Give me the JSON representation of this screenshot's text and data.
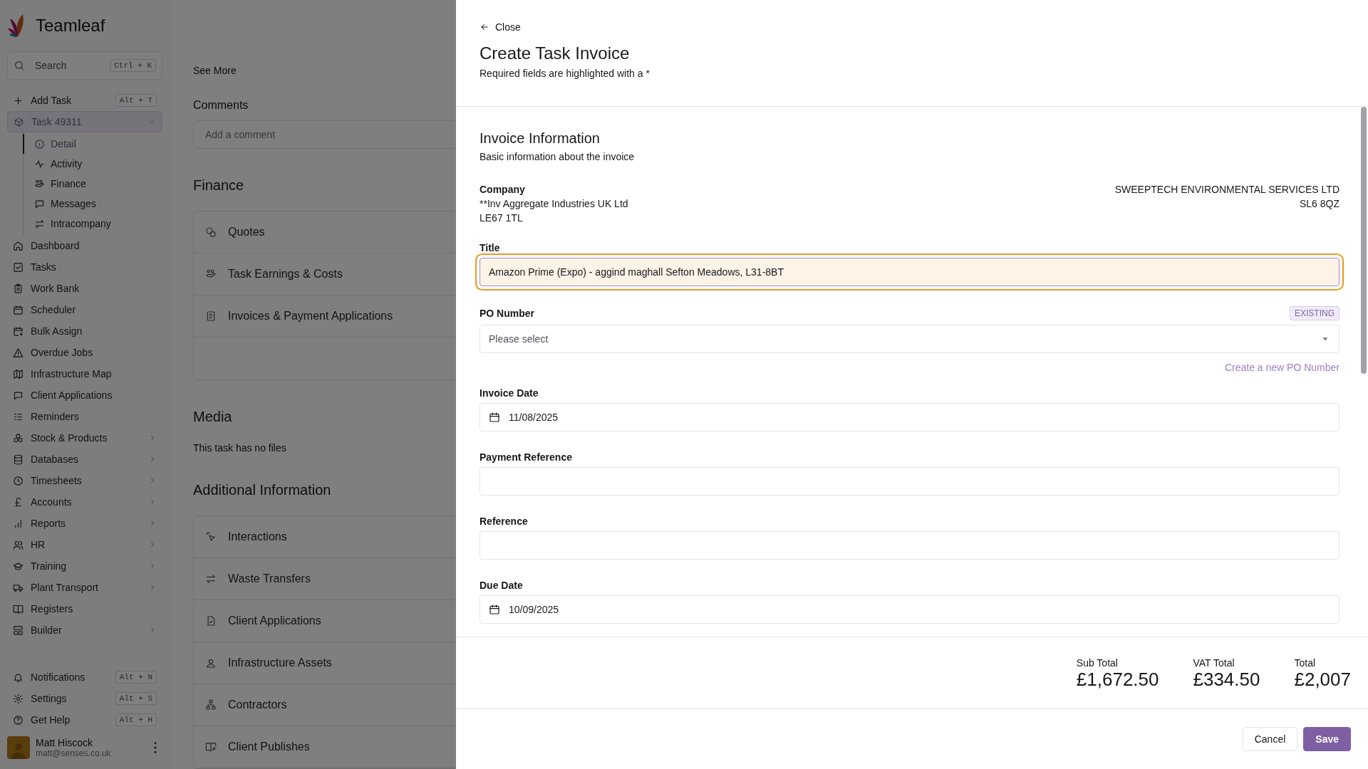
{
  "sidebar": {
    "brand": "Teamleaf",
    "search": {
      "placeholder": "Search",
      "shortcut": "Ctrl + K"
    },
    "add_task": {
      "label": "Add Task",
      "shortcut": "Alt + T"
    },
    "task": {
      "label": "Task 49311",
      "expanded": true,
      "selected": true,
      "children": [
        {
          "label": "Detail",
          "selected": true
        },
        {
          "label": "Activity",
          "selected": false
        },
        {
          "label": "Finance",
          "selected": false
        },
        {
          "label": "Messages",
          "selected": false
        },
        {
          "label": "Intracompany",
          "selected": false
        }
      ]
    },
    "items": [
      {
        "label": "Dashboard",
        "has_submenu": false
      },
      {
        "label": "Tasks",
        "has_submenu": false
      },
      {
        "label": "Work Bank",
        "has_submenu": false
      },
      {
        "label": "Scheduler",
        "has_submenu": false
      },
      {
        "label": "Bulk Assign",
        "has_submenu": false
      },
      {
        "label": "Overdue Jobs",
        "has_submenu": false
      },
      {
        "label": "Infrastructure Map",
        "has_submenu": false
      },
      {
        "label": "Client Applications",
        "has_submenu": false
      },
      {
        "label": "Reminders",
        "has_submenu": false
      },
      {
        "label": "Stock & Products",
        "has_submenu": true
      },
      {
        "label": "Databases",
        "has_submenu": true
      },
      {
        "label": "Timesheets",
        "has_submenu": true
      },
      {
        "label": "Accounts",
        "has_submenu": true
      },
      {
        "label": "Reports",
        "has_submenu": true
      },
      {
        "label": "HR",
        "has_submenu": true
      },
      {
        "label": "Training",
        "has_submenu": true
      },
      {
        "label": "Plant Transport",
        "has_submenu": true
      },
      {
        "label": "Registers",
        "has_submenu": false
      },
      {
        "label": "Builder",
        "has_submenu": true
      }
    ],
    "bottom_items": [
      {
        "label": "Notifications",
        "shortcut": "Alt + N"
      },
      {
        "label": "Settings",
        "shortcut": "Alt + S"
      },
      {
        "label": "Get Help",
        "shortcut": "Alt + H"
      }
    ],
    "user": {
      "name": "Matt Hiscock",
      "email": "matt@senses.co.uk"
    }
  },
  "page": {
    "see_more": "See More",
    "comments": {
      "heading": "Comments",
      "placeholder": "Add a comment"
    },
    "finance": {
      "heading": "Finance",
      "items": [
        "Quotes",
        "Task Earnings & Costs",
        "Invoices & Payment Applications"
      ]
    },
    "media": {
      "heading": "Media",
      "empty": "This task has no files"
    },
    "additional": {
      "heading": "Additional Information",
      "items": [
        "Interactions",
        "Waste Transfers",
        "Client Applications",
        "Infrastructure Assets",
        "Contractors",
        "Client Publishes"
      ]
    }
  },
  "drawer": {
    "close": "Close",
    "title": "Create Task Invoice",
    "subtitle": "Required fields are highlighted with a *",
    "section": {
      "title": "Invoice Information",
      "subtitle": "Basic information about the invoice"
    },
    "company": {
      "label": "Company",
      "lines": [
        "**Inv Aggregate Industries UK Ltd",
        "LE67 1TL"
      ],
      "supplier_lines": [
        "SWEEPTECH ENVIRONMENTAL SERVICES LTD",
        "SL6 8QZ"
      ]
    },
    "fields": [
      {
        "kind": "text",
        "label": "Title",
        "value": "Amazon Prime (Expo) - aggind maghall Sefton Meadows, L31-8BT",
        "focused": true
      },
      {
        "kind": "select",
        "label": "PO Number",
        "placeholder": "Please select",
        "badge": "EXISTING",
        "link": "Create a new PO Number",
        "focused": false
      },
      {
        "kind": "date",
        "label": "Invoice Date",
        "value": "11/08/2025",
        "focused": false
      },
      {
        "kind": "text",
        "label": "Payment Reference",
        "focused": false
      },
      {
        "kind": "text",
        "label": "Reference",
        "focused": false
      },
      {
        "kind": "date",
        "label": "Due Date",
        "value": "10/09/2025",
        "focused": false
      }
    ],
    "totals": [
      {
        "label": "Sub Total",
        "value": "£1,672.50"
      },
      {
        "label": "VAT Total",
        "value": "£334.50"
      },
      {
        "label": "Total",
        "value": "£2,007"
      }
    ],
    "cancel": "Cancel",
    "save": "Save"
  }
}
